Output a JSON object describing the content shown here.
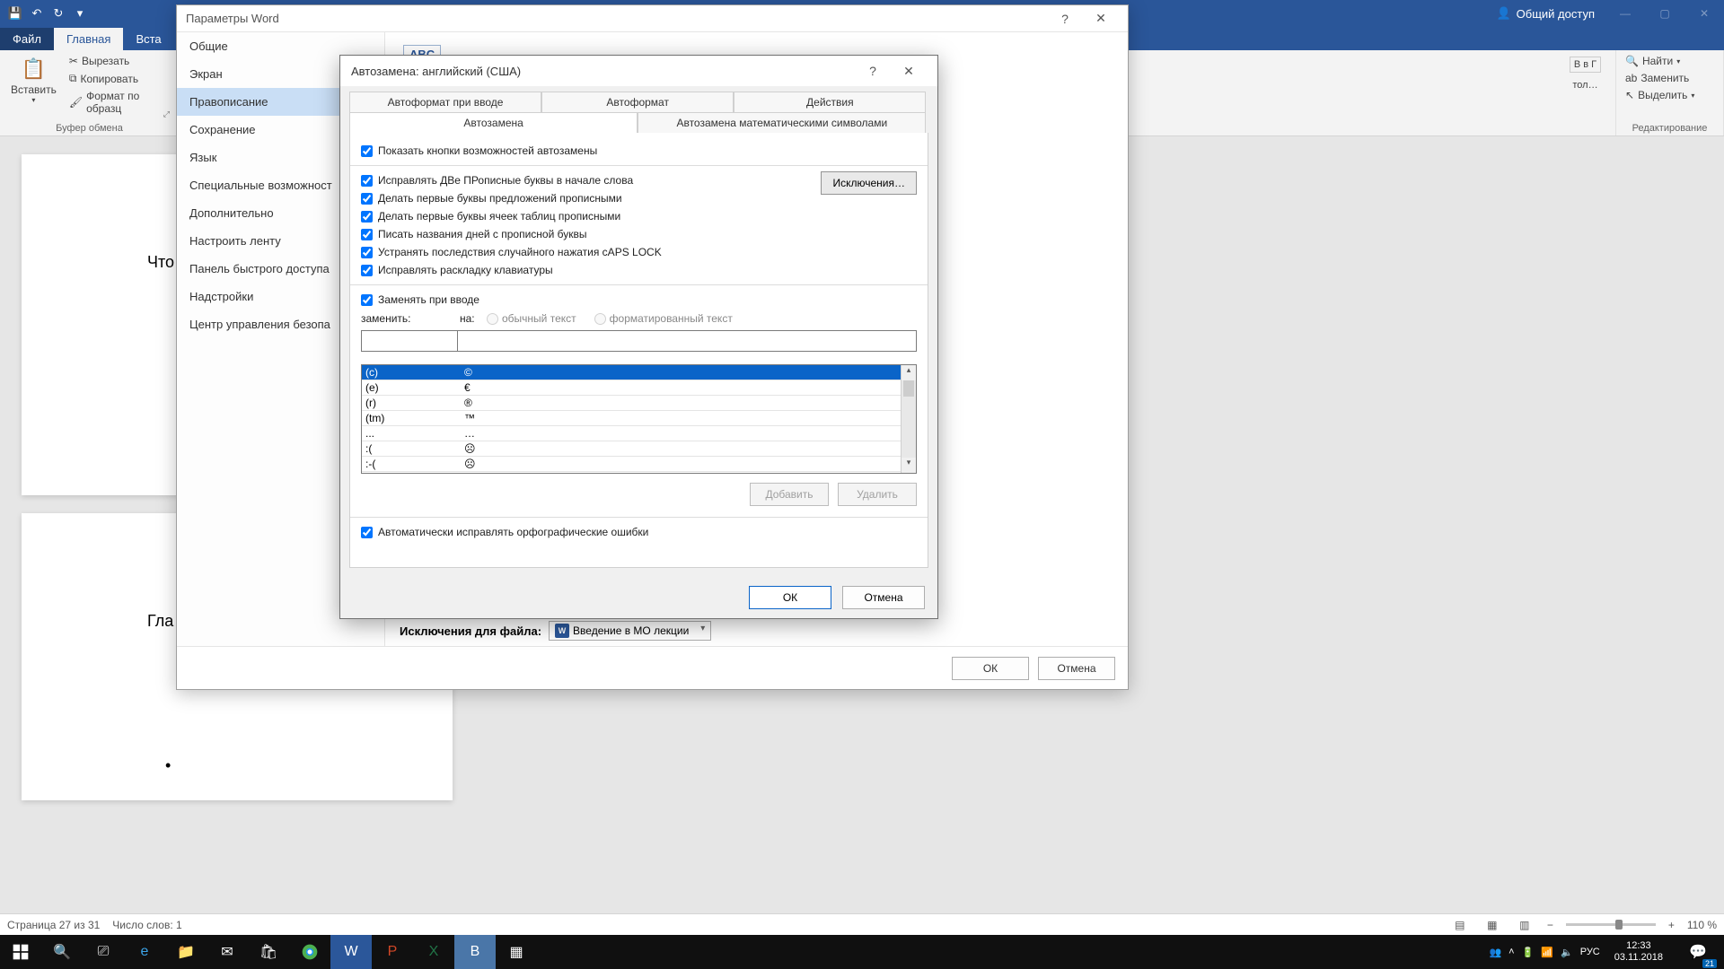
{
  "word_titlebar": {
    "share": "Общий доступ"
  },
  "ribbon_tabs": {
    "file": "Файл",
    "home": "Главная",
    "insert": "Вста"
  },
  "ribbon": {
    "paste": "Вставить",
    "cut": "Вырезать",
    "copy": "Копировать",
    "format_painter": "Формат по образц",
    "clipboard_label": "Буфер обмена",
    "font1": "В в Г",
    "font2": "тол…",
    "find": "Найти",
    "replace": "Заменить",
    "select": "Выделить",
    "editing_label": "Редактирование"
  },
  "doc": {
    "line1": "Что",
    "line2": "Гла",
    "bullet": "•"
  },
  "options_dialog": {
    "title": "Параметры Word",
    "nav": [
      "Общие",
      "Экран",
      "Правописание",
      "Сохранение",
      "Язык",
      "Специальные возможност",
      "Дополнительно",
      "Настроить ленту",
      "Панель быстрого доступа",
      "Надстройки",
      "Центр управления безопа"
    ],
    "nav_active_index": 2,
    "abc": "ABC",
    "exceptions_label": "Исключения для файла:",
    "file_dropdown": "Введение в МО лекции",
    "ok": "ОК",
    "cancel": "Отмена"
  },
  "ac_dialog": {
    "title": "Автозамена: английский (США)",
    "help": "?",
    "tabs_row1": [
      "Автоформат при вводе",
      "Автоформат",
      "Действия"
    ],
    "tabs_row2": [
      "Автозамена",
      "Автозамена математическими символами"
    ],
    "active_tab": "Автозамена",
    "show_buttons": "Показать кнопки возможностей автозамены",
    "checks": [
      "Исправлять ДВе ПРописные буквы в начале слова",
      "Делать первые буквы предложений прописными",
      "Делать первые буквы ячеек таблиц прописными",
      "Писать названия дней с прописной буквы",
      "Устранять последствия случайного нажатия cAPS LOCK",
      "Исправлять раскладку клавиатуры"
    ],
    "exceptions_btn": "Исключения…",
    "replace_on_type": "Заменять при вводе",
    "replace_label": "заменить:",
    "with_label": "на:",
    "plain_text": "обычный текст",
    "formatted_text": "форматированный текст",
    "list": [
      {
        "from": "(c)",
        "to": "©"
      },
      {
        "from": "(e)",
        "to": "€"
      },
      {
        "from": "(r)",
        "to": "®"
      },
      {
        "from": "(tm)",
        "to": "™"
      },
      {
        "from": "...",
        "to": "…"
      },
      {
        "from": ":(",
        "to": "☹"
      },
      {
        "from": ":-(",
        "to": "☹"
      }
    ],
    "selected_index": 0,
    "add": "Добавить",
    "delete": "Удалить",
    "auto_spell": "Автоматически исправлять орфографические ошибки",
    "ok": "ОК",
    "cancel": "Отмена"
  },
  "statusbar": {
    "page": "Страница 27 из 31",
    "words": "Число слов: 1",
    "zoom": "110 %",
    "plus": "+",
    "minus": "−"
  },
  "taskbar": {
    "lang": "РУС",
    "time": "12:33",
    "date": "03.11.2018",
    "notif_count": "21"
  }
}
